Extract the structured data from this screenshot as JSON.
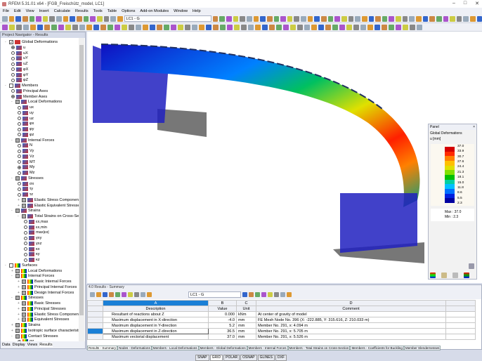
{
  "window": {
    "title": "RFEM 5.31.01 x64 - [FGB_Freischütz_model, LC1]",
    "min": "–",
    "max": "□",
    "close": "✕"
  },
  "menu": [
    "File",
    "Edit",
    "View",
    "Insert",
    "Calculate",
    "Results",
    "Tools",
    "Table",
    "Options",
    "Add-on Modules",
    "Window",
    "Help"
  ],
  "toolbar": {
    "loadcase": "LC1 - G"
  },
  "navigator": {
    "title": "Project Navigator - Results",
    "tabs": [
      "Data",
      "Display",
      "Views",
      "Results"
    ],
    "items": [
      {
        "l": 0,
        "t": "cb",
        "on": true,
        "label": "Global Deformations",
        "ex": "-"
      },
      {
        "l": 1,
        "t": "rb",
        "on": true,
        "label": "u"
      },
      {
        "l": 1,
        "t": "rb",
        "label": "uX"
      },
      {
        "l": 1,
        "t": "rb",
        "label": "uY"
      },
      {
        "l": 1,
        "t": "rb",
        "label": "uZ"
      },
      {
        "l": 1,
        "t": "rb",
        "label": "φX"
      },
      {
        "l": 1,
        "t": "rb",
        "label": "φY"
      },
      {
        "l": 1,
        "t": "rb",
        "label": "φZ"
      },
      {
        "l": 0,
        "t": "cb",
        "label": "Members",
        "ex": "-"
      },
      {
        "l": 1,
        "t": "rb",
        "label": "Principal Axes"
      },
      {
        "l": 1,
        "t": "rb",
        "on": true,
        "label": "Member Axes"
      },
      {
        "l": 1,
        "t": "cbp",
        "label": "Local Deformations",
        "ex": "-"
      },
      {
        "l": 2,
        "t": "rb",
        "label": "ux"
      },
      {
        "l": 2,
        "t": "rb",
        "label": "uy"
      },
      {
        "l": 2,
        "t": "rb",
        "label": "uz"
      },
      {
        "l": 2,
        "t": "rb",
        "label": "φx"
      },
      {
        "l": 2,
        "t": "rb",
        "label": "φy"
      },
      {
        "l": 2,
        "t": "rb",
        "label": "φz"
      },
      {
        "l": 1,
        "t": "cbp",
        "label": "Internal Forces",
        "ex": "-"
      },
      {
        "l": 2,
        "t": "rb",
        "label": "N"
      },
      {
        "l": 2,
        "t": "rb",
        "label": "Vy"
      },
      {
        "l": 2,
        "t": "rb",
        "label": "Vz"
      },
      {
        "l": 2,
        "t": "rb",
        "label": "MT"
      },
      {
        "l": 2,
        "t": "rb",
        "on": true,
        "label": "My"
      },
      {
        "l": 2,
        "t": "rb",
        "label": "Mz"
      },
      {
        "l": 1,
        "t": "cbp",
        "label": "Stresses",
        "ex": "-"
      },
      {
        "l": 2,
        "t": "rb",
        "label": "σx"
      },
      {
        "l": 2,
        "t": "rb",
        "label": "τy"
      },
      {
        "l": 2,
        "t": "rb",
        "label": "τz"
      },
      {
        "l": 2,
        "t": "cbp",
        "label": "Elastic Stress Components",
        "ex": "+"
      },
      {
        "l": 2,
        "t": "cbp",
        "label": "Elastic Equivalent Stresses",
        "ex": "+"
      },
      {
        "l": 1,
        "t": "cbp",
        "label": "Strains",
        "ex": "-"
      },
      {
        "l": 2,
        "t": "cbp",
        "label": "Total Strains on Cross-Section",
        "ex": "-"
      },
      {
        "l": 3,
        "t": "rb",
        "label": "εx,max"
      },
      {
        "l": 3,
        "t": "rb",
        "label": "εx,min"
      },
      {
        "l": 3,
        "t": "rb",
        "label": "max|εx|"
      },
      {
        "l": 3,
        "t": "rb",
        "label": "γxy"
      },
      {
        "l": 3,
        "t": "rb",
        "label": "γxz"
      },
      {
        "l": 3,
        "t": "rb",
        "label": "κx"
      },
      {
        "l": 3,
        "t": "rb",
        "label": "κy"
      },
      {
        "l": 3,
        "t": "rb",
        "label": "κz"
      },
      {
        "l": 0,
        "t": "cb",
        "label": "Surfaces",
        "ex": "-"
      },
      {
        "l": 1,
        "t": "cbp",
        "label": "Local Deformations",
        "ex": "+"
      },
      {
        "l": 1,
        "t": "cbp",
        "label": "Internal Forces",
        "ex": "-"
      },
      {
        "l": 2,
        "t": "cbp",
        "label": "Basic Internal Forces",
        "ex": "+"
      },
      {
        "l": 2,
        "t": "cbp",
        "label": "Principal Internal Forces",
        "ex": "+"
      },
      {
        "l": 2,
        "t": "cbp",
        "label": "Design Internal Forces",
        "ex": "+"
      },
      {
        "l": 1,
        "t": "cbp",
        "label": "Stresses",
        "ex": "-"
      },
      {
        "l": 2,
        "t": "cbp",
        "label": "Basic Stresses",
        "ex": "+"
      },
      {
        "l": 2,
        "t": "cbp",
        "label": "Principal Stresses",
        "ex": "+"
      },
      {
        "l": 2,
        "t": "cbp",
        "label": "Elastic Stress Components",
        "ex": "+"
      },
      {
        "l": 2,
        "t": "cbp",
        "label": "Equivalent Stresses",
        "ex": "+"
      },
      {
        "l": 1,
        "t": "cbp",
        "label": "Strains",
        "ex": "+"
      },
      {
        "l": 1,
        "t": "cbp",
        "label": "Isotropic surface characteristics",
        "ex": "+"
      },
      {
        "l": 1,
        "t": "cbp",
        "label": "Contact Stresses",
        "ex": "-"
      },
      {
        "l": 2,
        "t": "rb",
        "on": true,
        "label": "σz"
      }
    ]
  },
  "panel": {
    "title": "Panel",
    "close": "×",
    "heading": "Global Deformations",
    "unit": "u [mm]",
    "scale": [
      "37.0",
      "33.9",
      "30.7",
      "27.6",
      "24.4",
      "21.3",
      "18.1",
      "15.0",
      "11.8",
      "8.6",
      "5.5",
      "2.3"
    ],
    "colors": [
      "#d40000",
      "#ff2a00",
      "#ff8000",
      "#ffc000",
      "#e0e000",
      "#80e000",
      "#00c000",
      "#00d0a0",
      "#00c0ff",
      "#0070ff",
      "#0020e0",
      "#0000a0"
    ],
    "max_label": "Max",
    "max": "37.0",
    "min_label": "Min",
    "min": "2.3"
  },
  "results": {
    "title": "4.0 Results - Summary",
    "loadcase": "LC1 - G",
    "col_letters": [
      "A",
      "B",
      "C",
      "D"
    ],
    "headers": [
      "Description",
      "Value",
      "Unit",
      "Comment"
    ],
    "rows": [
      [
        "Resultant of reactions about Z",
        "0.000",
        "kNm",
        "At center of gravity of model"
      ],
      [
        "Maximum displacement in X-direction",
        "-4.0",
        "mm",
        "FE Mesh Node No. 396 (X: -222.885,  Y: 315.616,  Z: 210.033 m)"
      ],
      [
        "Maximum displacement in Y-direction",
        "5.2",
        "mm",
        "Member No. 291,  x: 4.094 m"
      ],
      [
        "Maximum displacement in Z-direction",
        "36.5",
        "mm",
        "Member No. 291,  x: 5.705 m"
      ],
      [
        "Maximum vectorial displacement",
        "37.0",
        "mm",
        "Member No. 291,  x: 5.526 m"
      ]
    ],
    "tabs": [
      "Results - Summary",
      "Nodes - Deformations",
      "Members - Local Deformations",
      "Members - Global Deformations",
      "Members - Internal Forces",
      "Members - Total Strains on Cross-Section",
      "Members - Coefficients for Buckling",
      "Member Slendernesses"
    ]
  },
  "status": [
    "SNAP",
    "GRID",
    "POLAR",
    "OSNAP",
    "GLINES",
    "DXF"
  ]
}
